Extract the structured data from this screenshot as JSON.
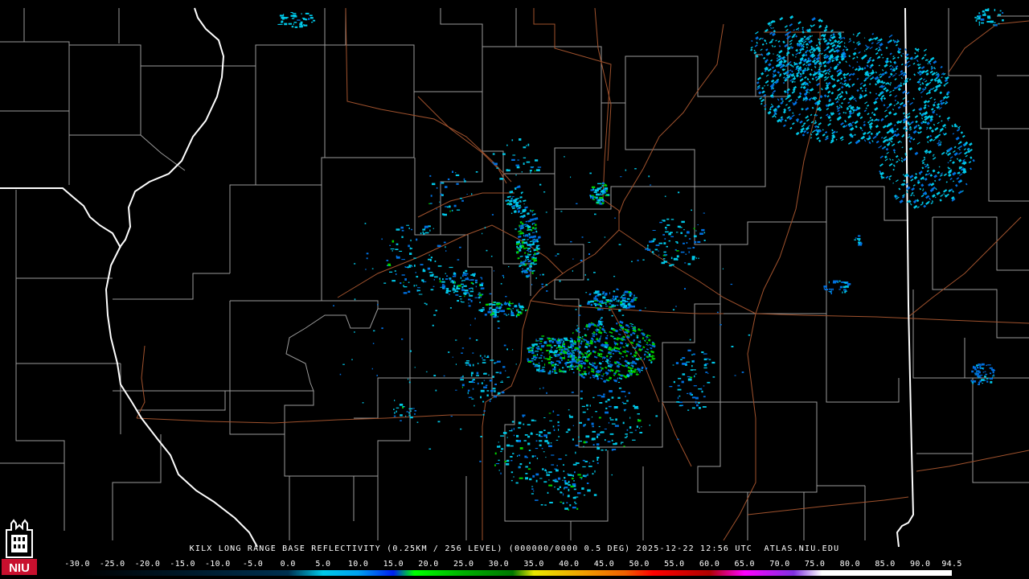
{
  "product": {
    "title": "KILX LONG RANGE BASE REFLECTIVITY (0.25KM / 256 LEVEL) (000000/0000 0.5 DEG) 2025-12-22 12:56 UTC  ATLAS.NIU.EDU"
  },
  "colorbar": {
    "ticks": [
      "-30.0",
      "-25.0",
      "-20.0",
      "-15.0",
      "-10.0",
      "-5.0",
      "0.0",
      "5.0",
      "10.0",
      "15.0",
      "20.0",
      "25.0",
      "30.0",
      "35.0",
      "40.0",
      "45.0",
      "50.0",
      "55.0",
      "60.0",
      "65.0",
      "70.0",
      "75.0",
      "80.0",
      "85.0",
      "90.0",
      "94.5"
    ],
    "range": [
      -30,
      94.5
    ],
    "stops": [
      {
        "value": -30,
        "color": "#000000"
      },
      {
        "value": 0,
        "color": "#003050"
      },
      {
        "value": 5,
        "color": "#00c8e8"
      },
      {
        "value": 10,
        "color": "#00a0f0"
      },
      {
        "value": 15,
        "color": "#0020f0"
      },
      {
        "value": 18,
        "color": "#00ff00"
      },
      {
        "value": 25,
        "color": "#00b000"
      },
      {
        "value": 32,
        "color": "#007800"
      },
      {
        "value": 35,
        "color": "#e8e800"
      },
      {
        "value": 42,
        "color": "#f0a000"
      },
      {
        "value": 48,
        "color": "#f06000"
      },
      {
        "value": 52,
        "color": "#ff0000"
      },
      {
        "value": 60,
        "color": "#b00000"
      },
      {
        "value": 65,
        "color": "#ff00ff"
      },
      {
        "value": 72,
        "color": "#8030e0"
      },
      {
        "value": 76,
        "color": "#ffffff"
      },
      {
        "value": 94.5,
        "color": "#ffffff"
      }
    ]
  },
  "colors": {
    "background": "#000000",
    "county_lines": "#9a9a9a",
    "state_lines": "#ffffff",
    "roads": "#a0522d",
    "light_echo": "#00c8e8",
    "moderate_echo": "#0070e0",
    "heavy_echo": "#00d000"
  },
  "logo": {
    "text": "NIU",
    "icon": "niu-tower-icon",
    "color": "#c8102e"
  }
}
